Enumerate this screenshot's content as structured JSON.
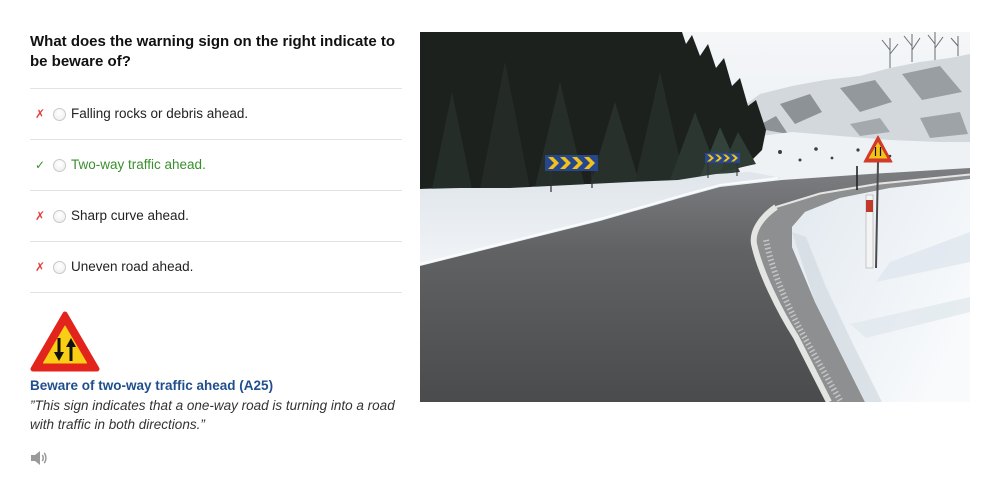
{
  "question": {
    "text": "What does the warning sign on the right indicate to be beware of?"
  },
  "options": [
    {
      "mark": "✗",
      "label": "Falling rocks or debris ahead.",
      "is_correct": false
    },
    {
      "mark": "✓",
      "label": "Two-way traffic ahead.",
      "is_correct": true
    },
    {
      "mark": "✗",
      "label": "Sharp curve ahead.",
      "is_correct": false
    },
    {
      "mark": "✗",
      "label": "Uneven road ahead.",
      "is_correct": false
    }
  ],
  "explanation": {
    "sign_icon": "two-way-traffic-warning-sign-icon",
    "title": "Beware of two-way traffic ahead (A25)",
    "text": "”This sign indicates that a one-way road is turning into a road with traffic in both directions.”",
    "audio_icon": "speaker-icon"
  },
  "icons": {
    "incorrect": "x-mark-icon",
    "correct": "check-mark-icon"
  },
  "colors": {
    "correct": "#3b8e2f",
    "incorrect": "#e0413b",
    "title": "#1f4f8c",
    "text": "#222222",
    "question": "#111111",
    "divider": "#e2e2e2",
    "sign_border": "#e3241d",
    "sign_fill": "#f8cf14"
  }
}
